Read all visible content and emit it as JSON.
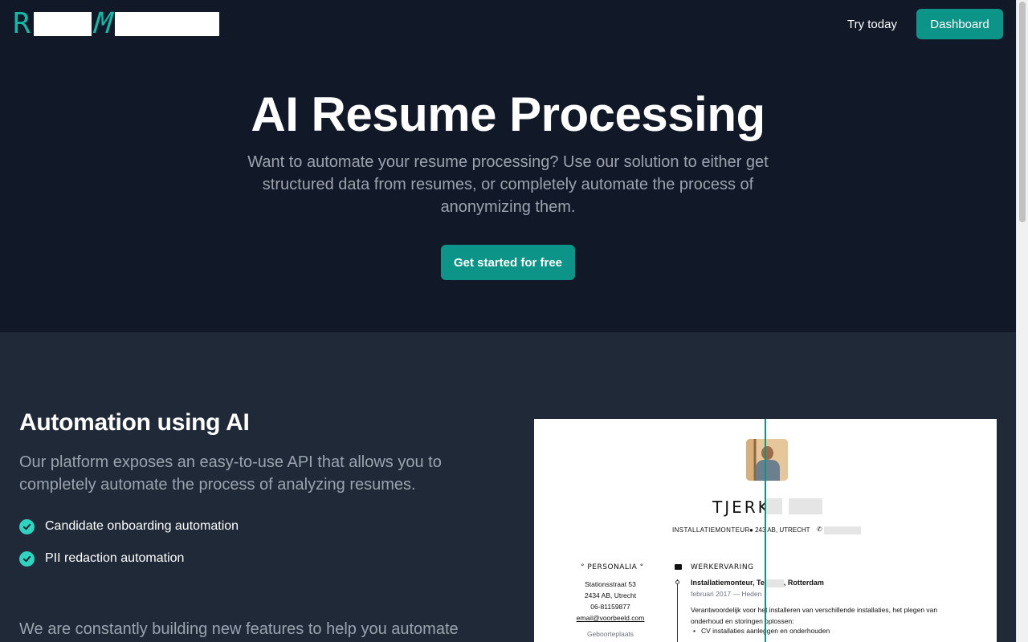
{
  "header": {
    "logo_letter_1": "R",
    "logo_letter_2": "M",
    "nav_try": "Try today",
    "dashboard_label": "Dashboard"
  },
  "hero": {
    "title": "AI Resume Processing",
    "subtitle": "Want to automate your resume processing? Use our solution to either get structured data from resumes, or completely automate the process of anonymizing them.",
    "cta_label": "Get started for free"
  },
  "features": {
    "title": "Automation using AI",
    "description": "Our platform exposes an easy-to-use API that allows you to completely automate the process of analyzing resumes.",
    "items": [
      {
        "label": "Candidate onboarding automation",
        "icon": "check-circle-icon"
      },
      {
        "label": "PII redaction automation",
        "icon": "check-circle-icon"
      }
    ],
    "more_text": "We are constantly building new features to help you automate"
  },
  "resume": {
    "name": "TJERK",
    "job_title": "INSTALLATIEMONTEUR",
    "location_prefix": "243",
    "location_suffix": "AB, UTRECHT",
    "personalia_heading": "PERSONALIA",
    "address_1": "Stationsstraat 53",
    "address_2": "2434 AB, Utrecht",
    "phone": "06-81159877",
    "email": "email@voorbeeld.com",
    "birthplace_label": "Geboorteplaats",
    "experience_heading": "WERKERVARING",
    "exp_title_prefix": "Installatiemonteur, Te",
    "exp_title_suffix": ", Rotterdam",
    "exp_date": "februari 2017 — Heden",
    "exp_description": "Verantwoordelijk voor het installeren van verschillende installaties, het plegen van onderhoud en storingen oplossen:",
    "exp_bullet_1": "CV installaties aanleggen en onderhouden"
  },
  "colors": {
    "accent": "#0d9488",
    "hero_bg": "#111827",
    "section_bg": "#1f2937",
    "check": "#2dd4bf"
  }
}
